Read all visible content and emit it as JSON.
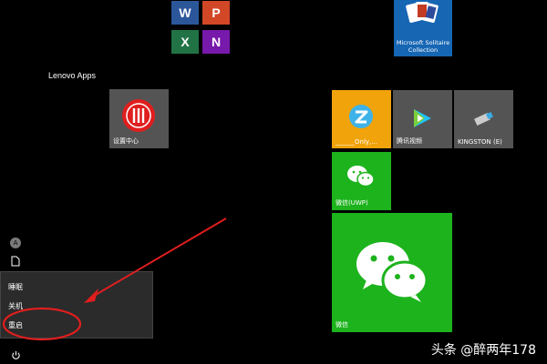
{
  "section": {
    "title": "Lenovo Apps"
  },
  "office": {
    "word": "W",
    "powerpoint": "P",
    "excel": "X",
    "onenote": "N"
  },
  "tiles": {
    "solitaire": {
      "label": "Microsoft Solitaire Collection"
    },
    "settings_center": {
      "label": "设置中心"
    },
    "qq_music": {
      "label": "______Only,..."
    },
    "tencent_video": {
      "label": "腾讯视频"
    },
    "kingston": {
      "label": "KINGSTON (E)"
    },
    "wechat_uwp": {
      "label": "微信(UWP)"
    },
    "wechat": {
      "label": "微信"
    }
  },
  "power_menu": {
    "items": [
      "睡眠",
      "关机",
      "重启"
    ]
  },
  "left_icons": {
    "user": "A"
  },
  "watermark": {
    "text": "头条 @醉两年178"
  },
  "colors": {
    "word": "#2b579a",
    "powerpoint": "#d24726",
    "excel": "#217346",
    "onenote": "#7719aa",
    "tile_gray": "#545454",
    "tile_yellow": "#f0a30a",
    "tile_green": "#1db31d",
    "accent_red": "#e01e1e"
  }
}
